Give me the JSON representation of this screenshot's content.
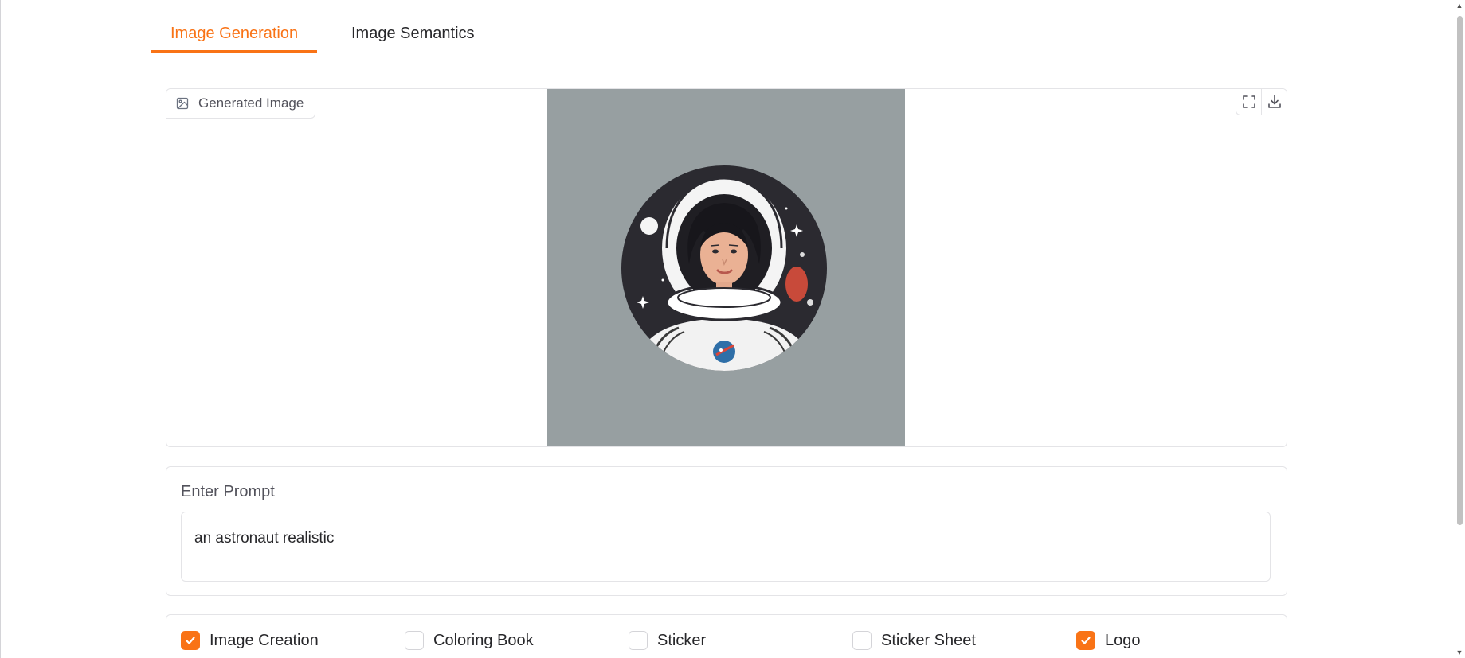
{
  "tabs": [
    {
      "label": "Image Generation",
      "active": true
    },
    {
      "label": "Image Semantics",
      "active": false
    }
  ],
  "output": {
    "label": "Generated Image",
    "label_icon": "image-icon",
    "actions": [
      {
        "name": "fullscreen-icon"
      },
      {
        "name": "download-icon"
      }
    ],
    "image_alt": "Generated astronaut illustration"
  },
  "prompt": {
    "label": "Enter Prompt",
    "value": "an astronaut realistic"
  },
  "options": [
    {
      "label": "Image Creation",
      "checked": true
    },
    {
      "label": "Coloring Book",
      "checked": false
    },
    {
      "label": "Sticker",
      "checked": false
    },
    {
      "label": "Sticker Sheet",
      "checked": false
    },
    {
      "label": "Logo",
      "checked": true
    }
  ],
  "colors": {
    "accent": "#f97316",
    "border": "#e4e4e7",
    "image_background": "#979fa1"
  }
}
